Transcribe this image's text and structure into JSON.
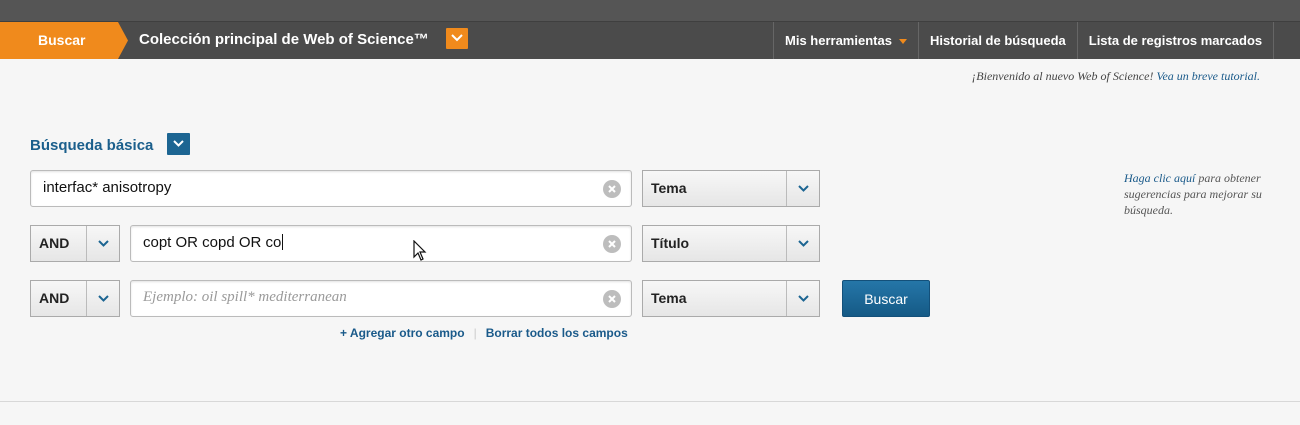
{
  "nav": {
    "search_tab": "Buscar",
    "collection_title": "Colección principal de Web of Science™",
    "links": [
      "Mis herramientas",
      "Historial de búsqueda",
      "Lista de registros marcados"
    ],
    "accent": "#f08a1c"
  },
  "welcome": {
    "text": "¡Bienvenido al nuevo Web of Science! ",
    "link": "Vea un breve tutorial."
  },
  "search": {
    "mode_label": "Búsqueda básica",
    "rows": [
      {
        "operator": "",
        "value": "interfac* anisotropy",
        "placeholder": "",
        "field": "Tema"
      },
      {
        "operator": "AND",
        "value": "copt OR copd OR co",
        "placeholder": "",
        "field": "Título"
      },
      {
        "operator": "AND",
        "value": "",
        "placeholder": "Ejemplo: oil spill* mediterranean",
        "field": "Tema"
      }
    ],
    "search_button": "Buscar",
    "add_field": "+ Agregar otro campo",
    "clear_fields": "Borrar todos los campos"
  },
  "hint": {
    "link": "Haga clic aquí",
    "text": " para obtener sugerencias para mejorar su búsqueda."
  }
}
